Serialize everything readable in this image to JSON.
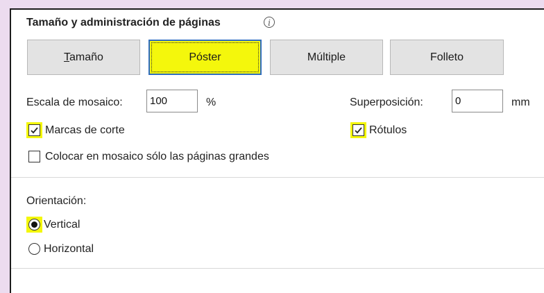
{
  "section": {
    "title": "Tamaño y administración de páginas",
    "info_icon": "info-icon"
  },
  "tabs": [
    {
      "label": "Tamaño",
      "active": false
    },
    {
      "label": "Póster",
      "active": true
    },
    {
      "label": "Múltiple",
      "active": false
    },
    {
      "label": "Folleto",
      "active": false
    }
  ],
  "poster": {
    "tile_scale_label": "Escala de mosaico:",
    "tile_scale_value": "100",
    "tile_scale_unit": "%",
    "overlap_label": "Superposición:",
    "overlap_value": "0",
    "overlap_unit": "mm",
    "cut_marks_label": "Marcas de corte",
    "cut_marks_checked": true,
    "labels_label": "Rótulos",
    "labels_checked": true,
    "large_pages_label": "Colocar en mosaico sólo las páginas grandes",
    "large_pages_checked": false
  },
  "orientation": {
    "label": "Orientación:",
    "options": [
      {
        "label": "Vertical",
        "selected": true
      },
      {
        "label": "Horizontal",
        "selected": false
      }
    ]
  },
  "colors": {
    "highlight": "#f4f70c",
    "focus_border": "#2f6dbf",
    "background": "#ecdcef"
  }
}
